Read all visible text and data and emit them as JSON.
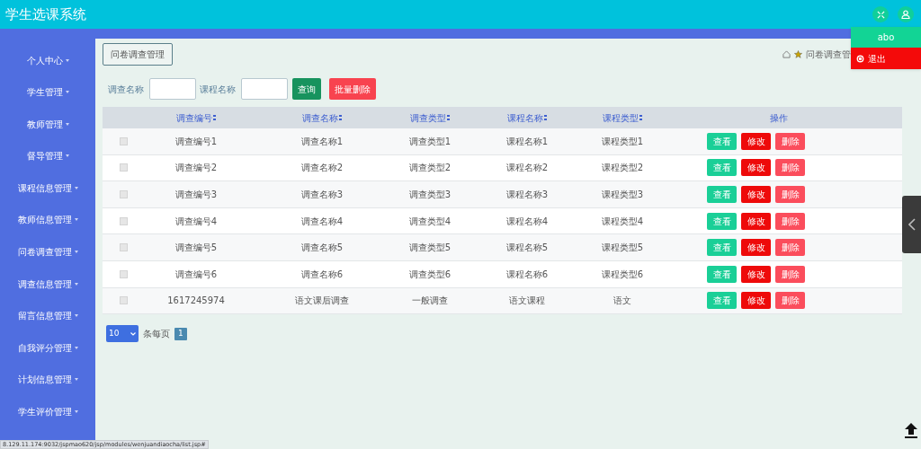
{
  "app_title": "学生选课系统",
  "user_menu": {
    "username": "abo",
    "logout": "退出"
  },
  "sidebar": {
    "items": [
      {
        "label": "个人中心"
      },
      {
        "label": "学生管理"
      },
      {
        "label": "教师管理"
      },
      {
        "label": "督导管理"
      },
      {
        "label": "课程信息管理"
      },
      {
        "label": "教师信息管理"
      },
      {
        "label": "问卷调查管理"
      },
      {
        "label": "调查信息管理"
      },
      {
        "label": "留言信息管理"
      },
      {
        "label": "自我评分管理"
      },
      {
        "label": "计划信息管理"
      },
      {
        "label": "学生评价管理"
      }
    ]
  },
  "page_title": "问卷调查管理",
  "breadcrumb": "问卷调查管",
  "search": {
    "fields": [
      {
        "label": "调查名称"
      },
      {
        "label": "课程名称"
      }
    ],
    "query_button": "查询",
    "batch_delete_button": "批量删除"
  },
  "table": {
    "columns": [
      {
        "label": "调查编号",
        "sortable": true
      },
      {
        "label": "调查名称",
        "sortable": true
      },
      {
        "label": "调查类型",
        "sortable": true
      },
      {
        "label": "课程名称",
        "sortable": true
      },
      {
        "label": "课程类型",
        "sortable": true
      },
      {
        "label": "操作",
        "sortable": false
      }
    ],
    "rows": [
      {
        "checked": false,
        "cells": [
          "调查编号1",
          "调查名称1",
          "调查类型1",
          "课程名称1",
          "课程类型1"
        ],
        "actions": [
          {
            "kind": "view",
            "label": "查看"
          },
          {
            "kind": "edit",
            "label": "修改"
          },
          {
            "kind": "delete",
            "label": "删除"
          }
        ]
      },
      {
        "checked": false,
        "cells": [
          "调查编号2",
          "调查名称2",
          "调查类型2",
          "课程名称2",
          "课程类型2"
        ],
        "actions": [
          {
            "kind": "view",
            "label": "查看"
          },
          {
            "kind": "edit",
            "label": "修改"
          },
          {
            "kind": "delete",
            "label": "删除"
          }
        ]
      },
      {
        "checked": false,
        "cells": [
          "调查编号3",
          "调查名称3",
          "调查类型3",
          "课程名称3",
          "课程类型3"
        ],
        "actions": [
          {
            "kind": "view",
            "label": "查看"
          },
          {
            "kind": "edit",
            "label": "修改"
          },
          {
            "kind": "delete",
            "label": "删除"
          }
        ]
      },
      {
        "checked": false,
        "cells": [
          "调查编号4",
          "调查名称4",
          "调查类型4",
          "课程名称4",
          "课程类型4"
        ],
        "actions": [
          {
            "kind": "view",
            "label": "查看"
          },
          {
            "kind": "edit",
            "label": "修改"
          },
          {
            "kind": "delete",
            "label": "删除"
          }
        ]
      },
      {
        "checked": false,
        "cells": [
          "调查编号5",
          "调查名称5",
          "调查类型5",
          "课程名称5",
          "课程类型5"
        ],
        "actions": [
          {
            "kind": "view",
            "label": "查看"
          },
          {
            "kind": "edit",
            "label": "修改"
          },
          {
            "kind": "delete",
            "label": "删除"
          }
        ]
      },
      {
        "checked": false,
        "cells": [
          "调查编号6",
          "调查名称6",
          "调查类型6",
          "课程名称6",
          "课程类型6"
        ],
        "actions": [
          {
            "kind": "view",
            "label": "查看"
          },
          {
            "kind": "edit",
            "label": "修改"
          },
          {
            "kind": "delete",
            "label": "删除"
          }
        ]
      },
      {
        "checked": false,
        "cells": [
          "1617245974",
          "语文课后调查",
          "一般调查",
          "语文课程",
          "语文"
        ],
        "actions": [
          {
            "kind": "view",
            "label": "查看"
          },
          {
            "kind": "edit",
            "label": "修改"
          },
          {
            "kind": "delete",
            "label": "删除"
          }
        ]
      }
    ]
  },
  "pagination": {
    "page_size": "10",
    "per_page_label": "条每页",
    "pages": [
      {
        "label": "1",
        "selected": true
      }
    ]
  },
  "status_url": "8.129.11.174:9032/jspmao620/jsp/modules/wenjuandiaocha/list.jsp#"
}
